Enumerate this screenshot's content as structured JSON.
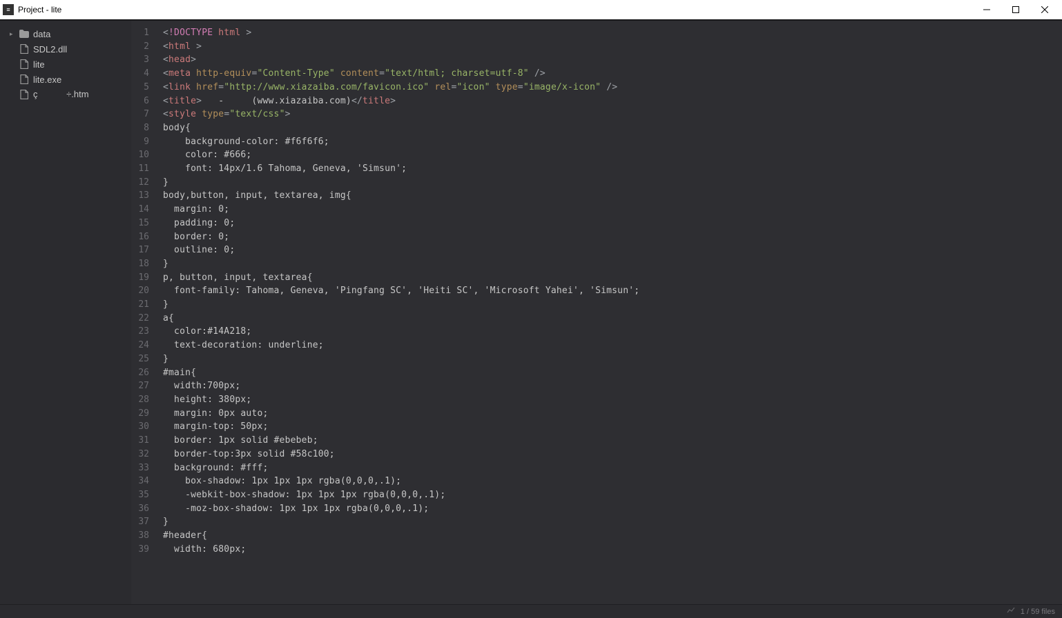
{
  "window": {
    "title": "Project - lite"
  },
  "sidebar": {
    "items": [
      {
        "type": "folder",
        "label": "data",
        "expandable": true
      },
      {
        "type": "file",
        "label": "SDL2.dll"
      },
      {
        "type": "file",
        "label": "lite"
      },
      {
        "type": "file",
        "label": "lite.exe"
      },
      {
        "type": "file",
        "label": "ç÷.htm"
      }
    ]
  },
  "editor": {
    "lines": [
      {
        "n": 1,
        "tokens": [
          {
            "t": "p",
            "v": "<"
          },
          {
            "t": "kw",
            "v": "!DOCTYPE"
          },
          {
            "t": "txt",
            "v": " "
          },
          {
            "t": "tag",
            "v": "html"
          },
          {
            "t": "txt",
            "v": " "
          },
          {
            "t": "p",
            "v": ">"
          }
        ]
      },
      {
        "n": 2,
        "tokens": [
          {
            "t": "p",
            "v": "<"
          },
          {
            "t": "tag",
            "v": "html"
          },
          {
            "t": "txt",
            "v": " "
          },
          {
            "t": "p",
            "v": ">"
          }
        ]
      },
      {
        "n": 3,
        "tokens": [
          {
            "t": "p",
            "v": "<"
          },
          {
            "t": "tag",
            "v": "head"
          },
          {
            "t": "p",
            "v": ">"
          }
        ]
      },
      {
        "n": 4,
        "tokens": [
          {
            "t": "p",
            "v": "<"
          },
          {
            "t": "tag",
            "v": "meta"
          },
          {
            "t": "txt",
            "v": " "
          },
          {
            "t": "attr",
            "v": "http-equiv"
          },
          {
            "t": "p",
            "v": "="
          },
          {
            "t": "str",
            "v": "\"Content-Type\""
          },
          {
            "t": "txt",
            "v": " "
          },
          {
            "t": "attr",
            "v": "content"
          },
          {
            "t": "p",
            "v": "="
          },
          {
            "t": "str",
            "v": "\"text/html; charset=utf-8\""
          },
          {
            "t": "txt",
            "v": " "
          },
          {
            "t": "p",
            "v": "/>"
          }
        ]
      },
      {
        "n": 5,
        "tokens": [
          {
            "t": "p",
            "v": "<"
          },
          {
            "t": "tag",
            "v": "link"
          },
          {
            "t": "txt",
            "v": " "
          },
          {
            "t": "attr",
            "v": "href"
          },
          {
            "t": "p",
            "v": "="
          },
          {
            "t": "str",
            "v": "\"http://www.xiazaiba.com/favicon.ico\""
          },
          {
            "t": "txt",
            "v": " "
          },
          {
            "t": "attr",
            "v": "rel"
          },
          {
            "t": "p",
            "v": "="
          },
          {
            "t": "str",
            "v": "\"icon\""
          },
          {
            "t": "txt",
            "v": " "
          },
          {
            "t": "attr",
            "v": "type"
          },
          {
            "t": "p",
            "v": "="
          },
          {
            "t": "str",
            "v": "\"image/x-icon\""
          },
          {
            "t": "txt",
            "v": " "
          },
          {
            "t": "p",
            "v": "/>"
          }
        ]
      },
      {
        "n": 6,
        "tokens": [
          {
            "t": "p",
            "v": "<"
          },
          {
            "t": "tag",
            "v": "title"
          },
          {
            "t": "p",
            "v": ">"
          },
          {
            "t": "txt",
            "v": "   -     (www.xiazaiba.com)"
          },
          {
            "t": "p",
            "v": "</"
          },
          {
            "t": "tag",
            "v": "title"
          },
          {
            "t": "p",
            "v": ">"
          }
        ]
      },
      {
        "n": 7,
        "tokens": [
          {
            "t": "p",
            "v": "<"
          },
          {
            "t": "tag",
            "v": "style"
          },
          {
            "t": "txt",
            "v": " "
          },
          {
            "t": "attr",
            "v": "type"
          },
          {
            "t": "p",
            "v": "="
          },
          {
            "t": "str",
            "v": "\"text/css\""
          },
          {
            "t": "p",
            "v": ">"
          }
        ]
      },
      {
        "n": 8,
        "tokens": [
          {
            "t": "txt",
            "v": "body{"
          }
        ]
      },
      {
        "n": 9,
        "tokens": [
          {
            "t": "txt",
            "v": "    background-color: #f6f6f6;"
          }
        ]
      },
      {
        "n": 10,
        "tokens": [
          {
            "t": "txt",
            "v": "    color: #666;"
          }
        ]
      },
      {
        "n": 11,
        "tokens": [
          {
            "t": "txt",
            "v": "    font: 14px/1.6 Tahoma, Geneva, 'Simsun';"
          }
        ]
      },
      {
        "n": 12,
        "tokens": [
          {
            "t": "txt",
            "v": "}"
          }
        ]
      },
      {
        "n": 13,
        "tokens": [
          {
            "t": "txt",
            "v": "body,button, input, textarea, img{"
          }
        ]
      },
      {
        "n": 14,
        "tokens": [
          {
            "t": "txt",
            "v": "  margin: 0;"
          }
        ]
      },
      {
        "n": 15,
        "tokens": [
          {
            "t": "txt",
            "v": "  padding: 0;"
          }
        ]
      },
      {
        "n": 16,
        "tokens": [
          {
            "t": "txt",
            "v": "  border: 0;"
          }
        ]
      },
      {
        "n": 17,
        "tokens": [
          {
            "t": "txt",
            "v": "  outline: 0;"
          }
        ]
      },
      {
        "n": 18,
        "tokens": [
          {
            "t": "txt",
            "v": "}"
          }
        ]
      },
      {
        "n": 19,
        "tokens": [
          {
            "t": "txt",
            "v": "p, button, input, textarea{"
          }
        ]
      },
      {
        "n": 20,
        "tokens": [
          {
            "t": "txt",
            "v": "  font-family: Tahoma, Geneva, 'Pingfang SC', 'Heiti SC', 'Microsoft Yahei', 'Simsun';"
          }
        ]
      },
      {
        "n": 21,
        "tokens": [
          {
            "t": "txt",
            "v": "}"
          }
        ]
      },
      {
        "n": 22,
        "tokens": [
          {
            "t": "txt",
            "v": "a{"
          }
        ]
      },
      {
        "n": 23,
        "tokens": [
          {
            "t": "txt",
            "v": "  color:#14A218;"
          }
        ]
      },
      {
        "n": 24,
        "tokens": [
          {
            "t": "txt",
            "v": "  text-decoration: underline;"
          }
        ]
      },
      {
        "n": 25,
        "tokens": [
          {
            "t": "txt",
            "v": "}"
          }
        ]
      },
      {
        "n": 26,
        "tokens": [
          {
            "t": "txt",
            "v": "#main{"
          }
        ]
      },
      {
        "n": 27,
        "tokens": [
          {
            "t": "txt",
            "v": "  width:700px;"
          }
        ]
      },
      {
        "n": 28,
        "tokens": [
          {
            "t": "txt",
            "v": "  height: 380px;"
          }
        ]
      },
      {
        "n": 29,
        "tokens": [
          {
            "t": "txt",
            "v": "  margin: 0px auto;"
          }
        ]
      },
      {
        "n": 30,
        "tokens": [
          {
            "t": "txt",
            "v": "  margin-top: 50px;"
          }
        ]
      },
      {
        "n": 31,
        "tokens": [
          {
            "t": "txt",
            "v": "  border: 1px solid #ebebeb;"
          }
        ]
      },
      {
        "n": 32,
        "tokens": [
          {
            "t": "txt",
            "v": "  border-top:3px solid #58c100;"
          }
        ]
      },
      {
        "n": 33,
        "tokens": [
          {
            "t": "txt",
            "v": "  background: #fff;"
          }
        ]
      },
      {
        "n": 34,
        "tokens": [
          {
            "t": "txt",
            "v": "    box-shadow: 1px 1px 1px rgba(0,0,0,.1);"
          }
        ]
      },
      {
        "n": 35,
        "tokens": [
          {
            "t": "txt",
            "v": "    -webkit-box-shadow: 1px 1px 1px rgba(0,0,0,.1);"
          }
        ]
      },
      {
        "n": 36,
        "tokens": [
          {
            "t": "txt",
            "v": "    -moz-box-shadow: 1px 1px 1px rgba(0,0,0,.1);"
          }
        ]
      },
      {
        "n": 37,
        "tokens": [
          {
            "t": "txt",
            "v": "}"
          }
        ]
      },
      {
        "n": 38,
        "tokens": [
          {
            "t": "txt",
            "v": "#header{"
          }
        ]
      },
      {
        "n": 39,
        "tokens": [
          {
            "t": "txt",
            "v": "  width: 680px;"
          }
        ]
      }
    ]
  },
  "status": {
    "indexing": "1 / 59 files"
  }
}
